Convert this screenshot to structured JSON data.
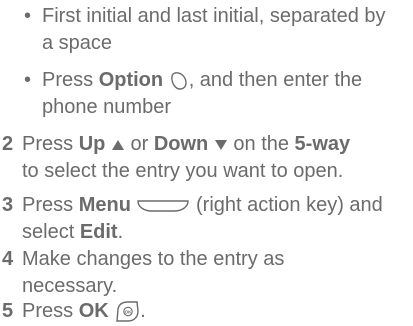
{
  "bullets": [
    {
      "line1": "First initial and last initial, separated by",
      "line2": "a space"
    },
    {
      "pre": "Press ",
      "bold": "Option",
      "post": ", and then enter the",
      "line2": "phone number"
    }
  ],
  "steps": [
    {
      "num": "2",
      "pre": "Press ",
      "bold1": "Up",
      "mid": " or ",
      "bold2": "Down",
      "post1": " on the ",
      "bold3": "5-way",
      "line2": "to select the entry you want to open."
    },
    {
      "num": "3",
      "pre": "Press ",
      "bold1": "Menu",
      "post": " (right action key) and",
      "line2_pre": "select ",
      "line2_bold": "Edit",
      "line2_post": "."
    },
    {
      "num": "4",
      "line1": "Make changes to the entry as",
      "line2": "necessary."
    },
    {
      "num": "5",
      "pre": "Press ",
      "bold1": "OK",
      "post": "."
    }
  ],
  "icons": {
    "option_key": "option-key-icon",
    "up_arrow": "up-arrow-icon",
    "down_arrow": "down-arrow-icon",
    "menu_key": "menu-key-icon",
    "ok_key": "ok-key-icon"
  }
}
